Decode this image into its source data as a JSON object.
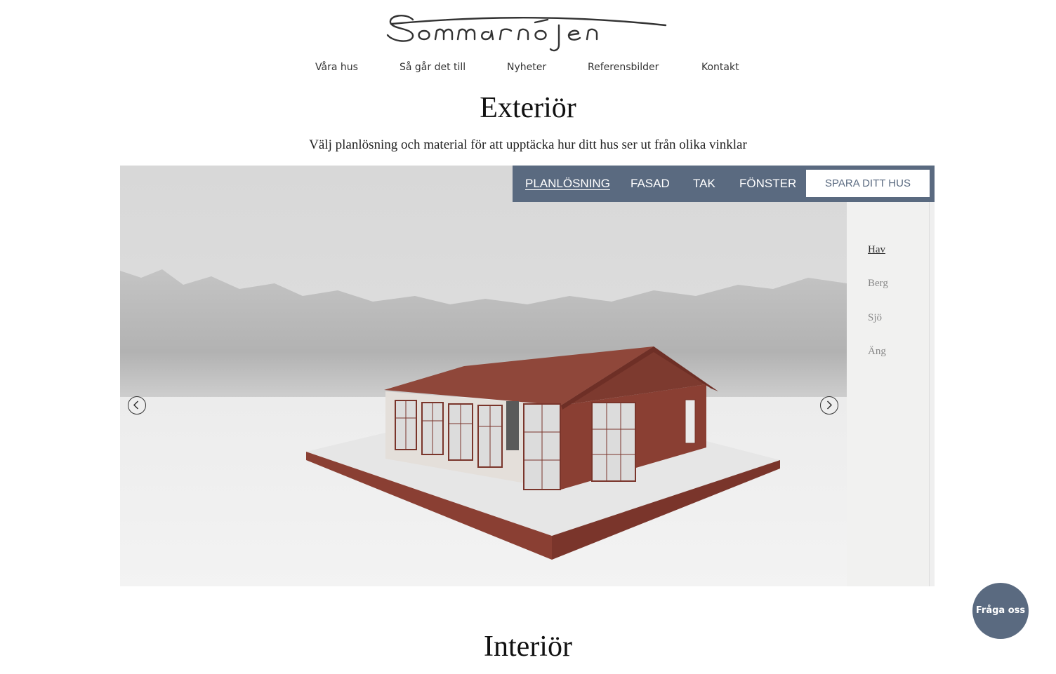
{
  "brand": {
    "logo_text": "Sommarnöjen"
  },
  "nav": {
    "items": [
      {
        "label": "Våra hus"
      },
      {
        "label": "Så går det till"
      },
      {
        "label": "Nyheter"
      },
      {
        "label": "Referensbilder"
      },
      {
        "label": "Kontakt"
      }
    ]
  },
  "exterior": {
    "title": "Exteriör",
    "subtitle": "Välj planlösning och material för att upptäcka hur ditt hus ser ut från olika vinklar"
  },
  "configurator": {
    "tabs": [
      {
        "label": "PLANLÖSNING",
        "active": true
      },
      {
        "label": "FASAD",
        "active": false
      },
      {
        "label": "TAK",
        "active": false
      },
      {
        "label": "FÖNSTER",
        "active": false
      }
    ],
    "save_label": "SPARA DITT HUS",
    "environments": [
      {
        "label": "Hav",
        "active": true
      },
      {
        "label": "Berg",
        "active": false
      },
      {
        "label": "Sjö",
        "active": false
      },
      {
        "label": "Äng",
        "active": false
      }
    ],
    "prev_icon": "chevron-left-icon",
    "next_icon": "chevron-right-icon",
    "colors": {
      "panel": "#5a6a80",
      "house": "#8a3f33"
    }
  },
  "interior": {
    "title": "Interiör"
  },
  "chat": {
    "label": "Fråga oss"
  }
}
